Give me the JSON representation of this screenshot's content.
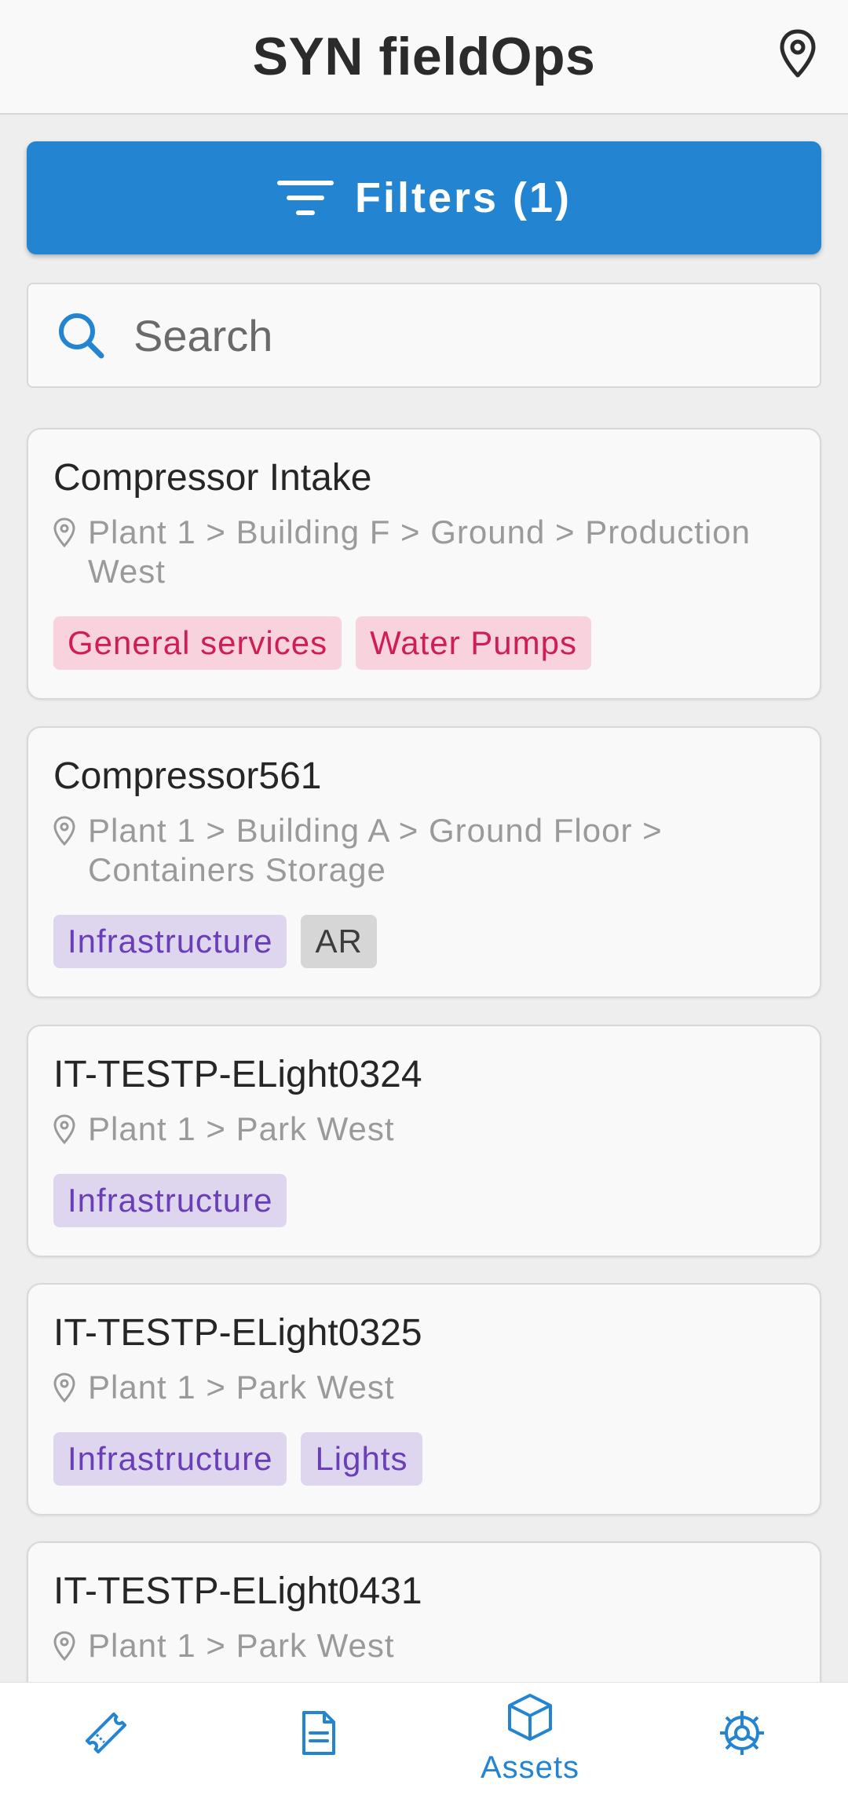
{
  "app": {
    "title": "SYN fieldOps"
  },
  "colors": {
    "accent": "#2385d1",
    "tag_pink": "#cf1d55",
    "tag_purple": "#6a3eb8"
  },
  "header": {
    "location_icon": "map-pin-icon"
  },
  "filters": {
    "label": "Filters (1)",
    "icon": "filter-lines-icon"
  },
  "search": {
    "placeholder": "Search",
    "value": "",
    "icon": "search-icon"
  },
  "assets": [
    {
      "name": "Compressor Intake",
      "location": "Plant 1 > Building F > Ground > Production West",
      "tags": [
        {
          "label": "General services",
          "style": "pink"
        },
        {
          "label": "Water Pumps",
          "style": "pink"
        }
      ]
    },
    {
      "name": "Compressor561",
      "location": "Plant 1 > Building A > Ground Floor > Containers Storage",
      "tags": [
        {
          "label": "Infrastructure",
          "style": "purple"
        },
        {
          "label": "AR",
          "style": "grey"
        }
      ]
    },
    {
      "name": "IT-TESTP-ELight0324",
      "location": "Plant 1 > Park West",
      "tags": [
        {
          "label": "Infrastructure",
          "style": "purple"
        }
      ]
    },
    {
      "name": "IT-TESTP-ELight0325",
      "location": "Plant 1 > Park West",
      "tags": [
        {
          "label": "Infrastructure",
          "style": "purple"
        },
        {
          "label": "Lights",
          "style": "purple"
        }
      ]
    },
    {
      "name": "IT-TESTP-ELight0431",
      "location": "Plant 1 > Park West",
      "tags": []
    }
  ],
  "bottom_nav": {
    "items": [
      {
        "icon": "ticket-icon",
        "label": ""
      },
      {
        "icon": "document-icon",
        "label": ""
      },
      {
        "icon": "cube-icon",
        "label": "Assets",
        "active": true
      },
      {
        "icon": "settings-cog-icon",
        "label": ""
      }
    ]
  }
}
